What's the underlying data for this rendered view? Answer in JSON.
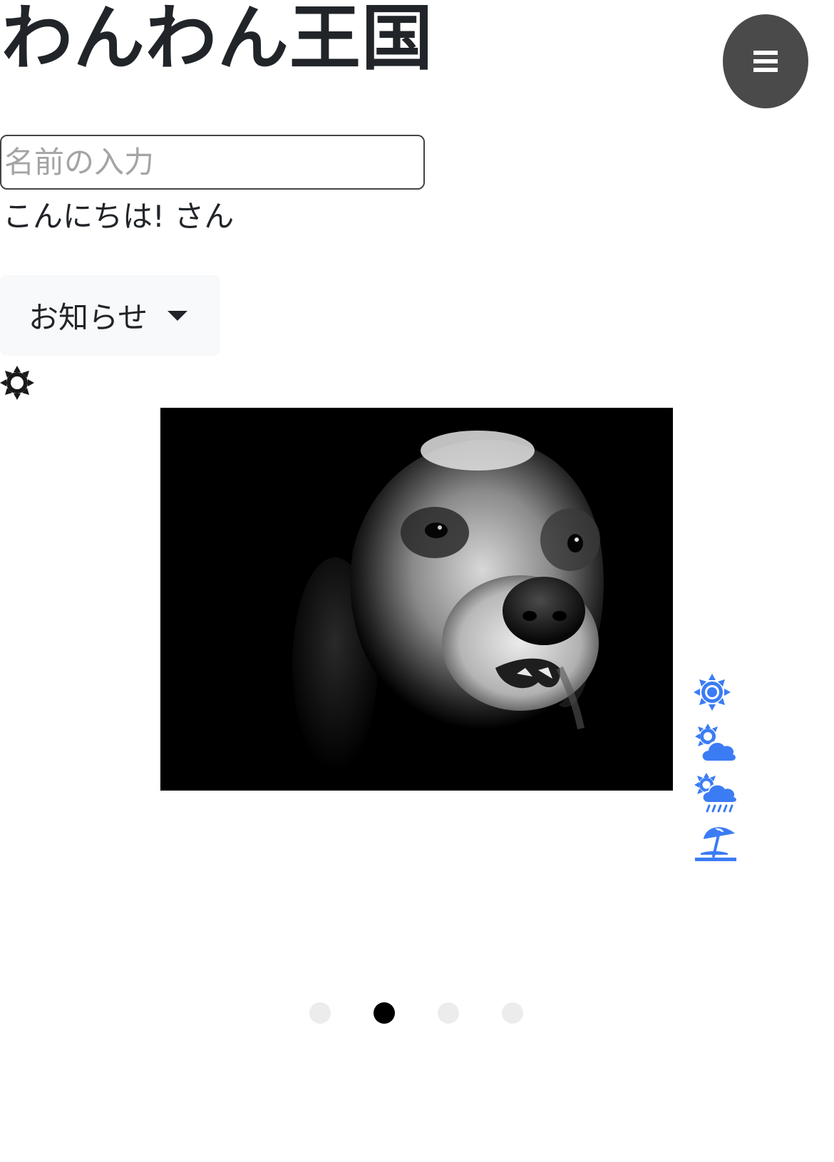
{
  "header": {
    "title": "わんわん王国"
  },
  "menu": {
    "icon": "hamburger-icon",
    "button_color": "#4a4a4a"
  },
  "name_form": {
    "placeholder": "名前の入力",
    "value": ""
  },
  "greeting": {
    "text": "こんにちは! さん"
  },
  "news_dropdown": {
    "label": "お知らせ",
    "icon": "caret-down-icon"
  },
  "theme_toggle": {
    "icon": "sun-icon"
  },
  "carousel": {
    "image_alt": "dog",
    "active_index": 1,
    "slide_count": 4
  },
  "weather_icons": [
    {
      "icon": "sun-icon"
    },
    {
      "icon": "sun-cloud-icon"
    },
    {
      "icon": "sun-rain-icon"
    },
    {
      "icon": "beach-umbrella-icon"
    }
  ],
  "colors": {
    "accent": "#3b7cf4",
    "text": "#212529",
    "dot_active": "#000000",
    "dot_inactive": "#ececec"
  }
}
